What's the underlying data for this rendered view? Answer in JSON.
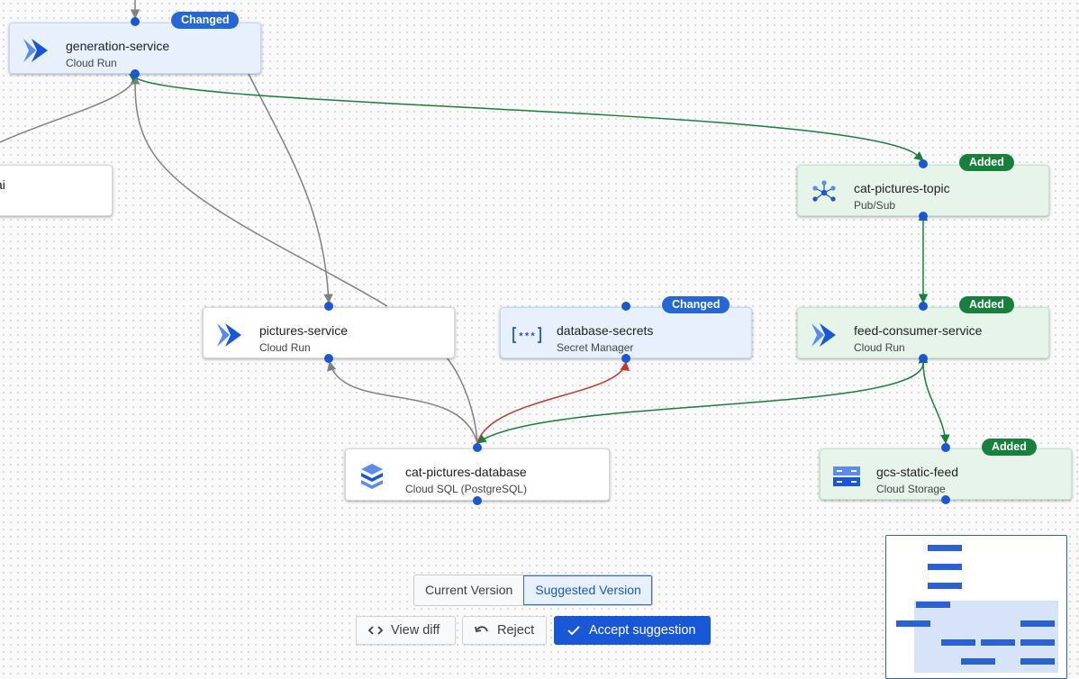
{
  "nodes": {
    "generation_service": {
      "title": "generation-service",
      "subtitle": "Cloud Run",
      "icon": "cloud-run-icon",
      "badge": "Changed"
    },
    "partial_node": {
      "title": "ai"
    },
    "cat_pictures_topic": {
      "title": "cat-pictures-topic",
      "subtitle": "Pub/Sub",
      "icon": "pubsub-icon",
      "badge": "Added"
    },
    "pictures_service": {
      "title": "pictures-service",
      "subtitle": "Cloud Run",
      "icon": "cloud-run-icon"
    },
    "database_secrets": {
      "title": "database-secrets",
      "subtitle": "Secret Manager",
      "icon": "secret-manager-icon",
      "badge": "Changed"
    },
    "feed_consumer_service": {
      "title": "feed-consumer-service",
      "subtitle": "Cloud Run",
      "icon": "cloud-run-icon",
      "badge": "Added"
    },
    "cat_pictures_database": {
      "title": "cat-pictures-database",
      "subtitle": "Cloud SQL (PostgreSQL)",
      "icon": "cloud-sql-icon"
    },
    "gcs_static_feed": {
      "title": "gcs-static-feed",
      "subtitle": "Cloud Storage",
      "icon": "cloud-storage-icon",
      "badge": "Added"
    }
  },
  "edge_colors": {
    "existing": "#808080",
    "added": "#17803d",
    "removed": "#c5372c",
    "port": "#1a57d6"
  },
  "version_toggle": {
    "current_label": "Current Version",
    "suggested_label": "Suggested Version",
    "selected": "Suggested Version"
  },
  "actions": {
    "view_diff_label": "View diff",
    "reject_label": "Reject",
    "accept_label": "Accept suggestion"
  },
  "colors": {
    "changed_badge": "#2567d6",
    "added_badge": "#17803d",
    "changed_node_bg": "#e8f0fe",
    "added_node_bg": "#e6f4ea",
    "primary": "#1a57d6"
  }
}
